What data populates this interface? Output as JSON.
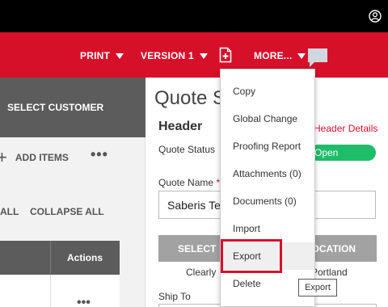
{
  "topbar": {
    "user_icon": "user-circle-icon"
  },
  "nav": {
    "print": "PRINT",
    "version": "VERSION 1",
    "more": "MORE...",
    "doc_icon": "document-add-icon",
    "chat_icon": "chat-bubble-icon"
  },
  "left_panel": {
    "select_customer": "SELECT CUSTOMER",
    "add_items": "ADD ITEMS",
    "more_dots": "•••",
    "expand_all": "ALL",
    "collapse_all": "COLLAPSE ALL",
    "table": {
      "actions_header": "Actions",
      "row_dots": "•••"
    }
  },
  "main": {
    "title": "Quote S",
    "section_header": "Header",
    "header_details_link": "Header Details",
    "quote_status_label": "Quote Status",
    "status_value": "Open",
    "quote_name_label": "Quote Name",
    "required_mark": "*",
    "quote_name_value": "Saberis Te",
    "select_btn_left": "SELECT",
    "select_btn_right": "OCATION",
    "clearly_text": "Clearly",
    "portland_text": "Portland",
    "ship_to_label": "Ship To"
  },
  "dropdown": {
    "items": [
      {
        "label": "Copy"
      },
      {
        "label": "Global Change"
      },
      {
        "label": "Proofing Report"
      },
      {
        "label": "Attachments (0)"
      },
      {
        "label": "Documents (0)"
      },
      {
        "label": "Import"
      },
      {
        "label": "Export"
      },
      {
        "label": "Delete"
      }
    ],
    "highlighted": "Export",
    "tooltip": "Export"
  },
  "colors": {
    "brand_red": "#d7102a",
    "status_green": "#1dbd6a",
    "dark_gray": "#5c5c5c"
  }
}
